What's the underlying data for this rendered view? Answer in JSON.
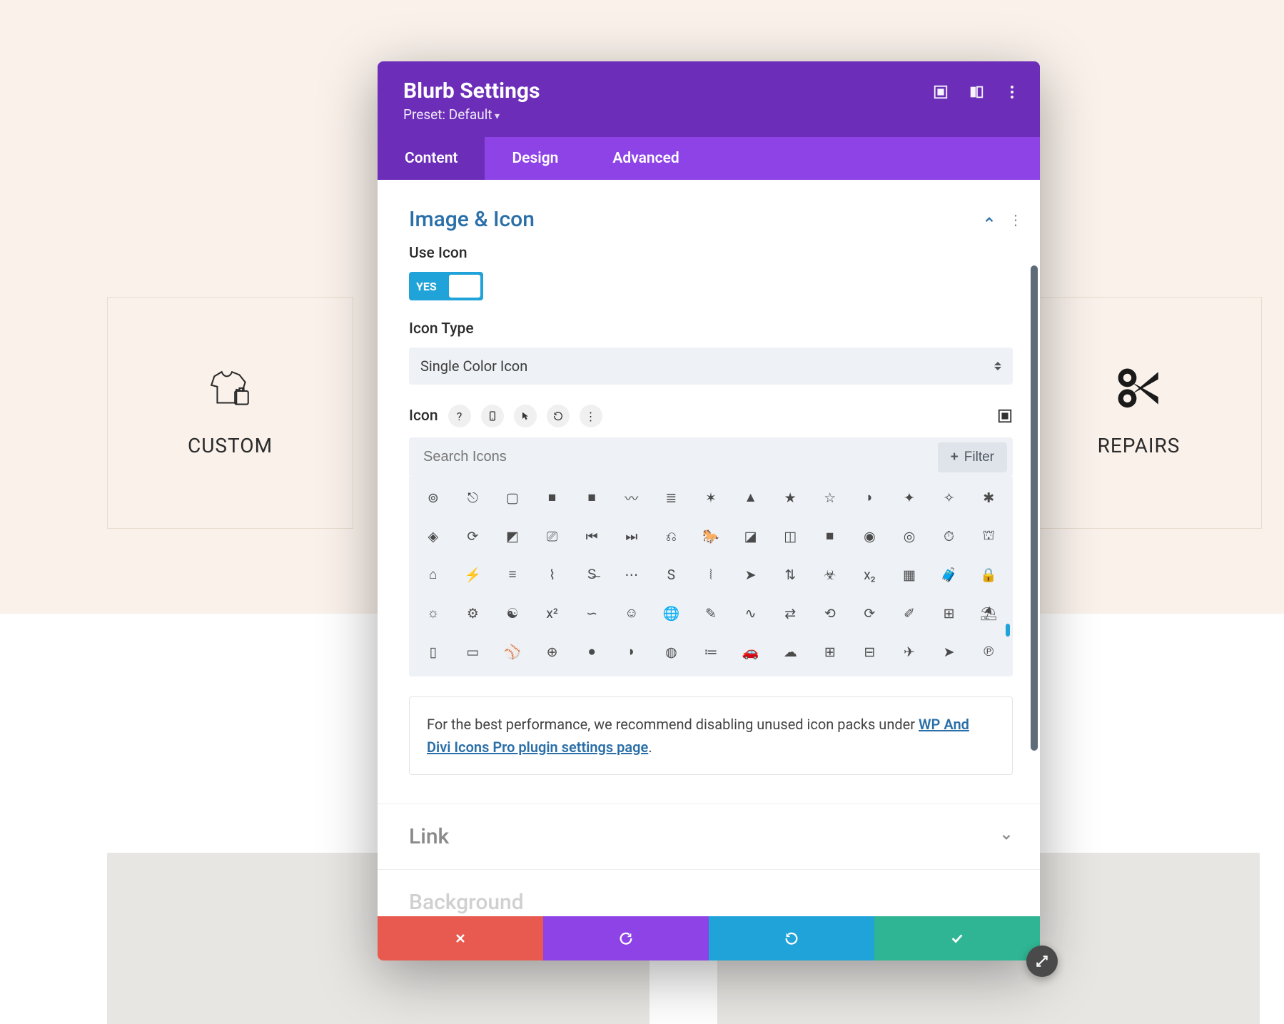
{
  "cards": {
    "left_label": "CUSTOM",
    "right_label": "REPAIRS"
  },
  "modal": {
    "title": "Blurb Settings",
    "preset": "Preset: Default",
    "tabs": {
      "content": "Content",
      "design": "Design",
      "advanced": "Advanced"
    },
    "section_image_icon": "Image & Icon",
    "use_icon_label": "Use Icon",
    "use_icon_value": "YES",
    "icon_type_label": "Icon Type",
    "icon_type_value": "Single Color Icon",
    "icon_label": "Icon",
    "search_placeholder": "Search Icons",
    "filter_label": "Filter",
    "info_text_pre": "For the best performance, we recommend disabling unused icon packs under ",
    "info_link": "WP And Divi Icons Pro plugin settings page",
    "info_text_post": ".",
    "link_section": "Link",
    "background_section": "Background"
  },
  "icon_grid_unicode": [
    "⊚",
    "⎋",
    "▢",
    "■",
    "■",
    "〰",
    "≣",
    "✶",
    "▲",
    "★",
    "☆",
    "◗",
    "✦",
    "✧",
    "✱",
    "◈",
    "⟳",
    "◩",
    "⎚",
    "⏮",
    "⏭",
    "⎌",
    "🐎",
    "◪",
    "◫",
    "■",
    "◉",
    "◎",
    "⏱",
    "⛫",
    "⌂",
    "⚡",
    "≡",
    "⌇",
    "S̶",
    "⋯",
    "S",
    "⦚",
    "➤",
    "⇅",
    "☣",
    "x₂",
    "▦",
    "🧳",
    "🔒",
    "☼",
    "⚙",
    "☯",
    "x²",
    "∽",
    "☺",
    "🌐",
    "✎",
    "∿",
    "⇄",
    "⟲",
    "⟳",
    "✐",
    "⊞",
    "⛱",
    "▯",
    "▭",
    "⚾",
    "⊕",
    "●",
    "◗",
    "◍",
    "≔",
    "🚗",
    "☁",
    "⊞",
    "⊟",
    "✈",
    "➤",
    "℗"
  ]
}
